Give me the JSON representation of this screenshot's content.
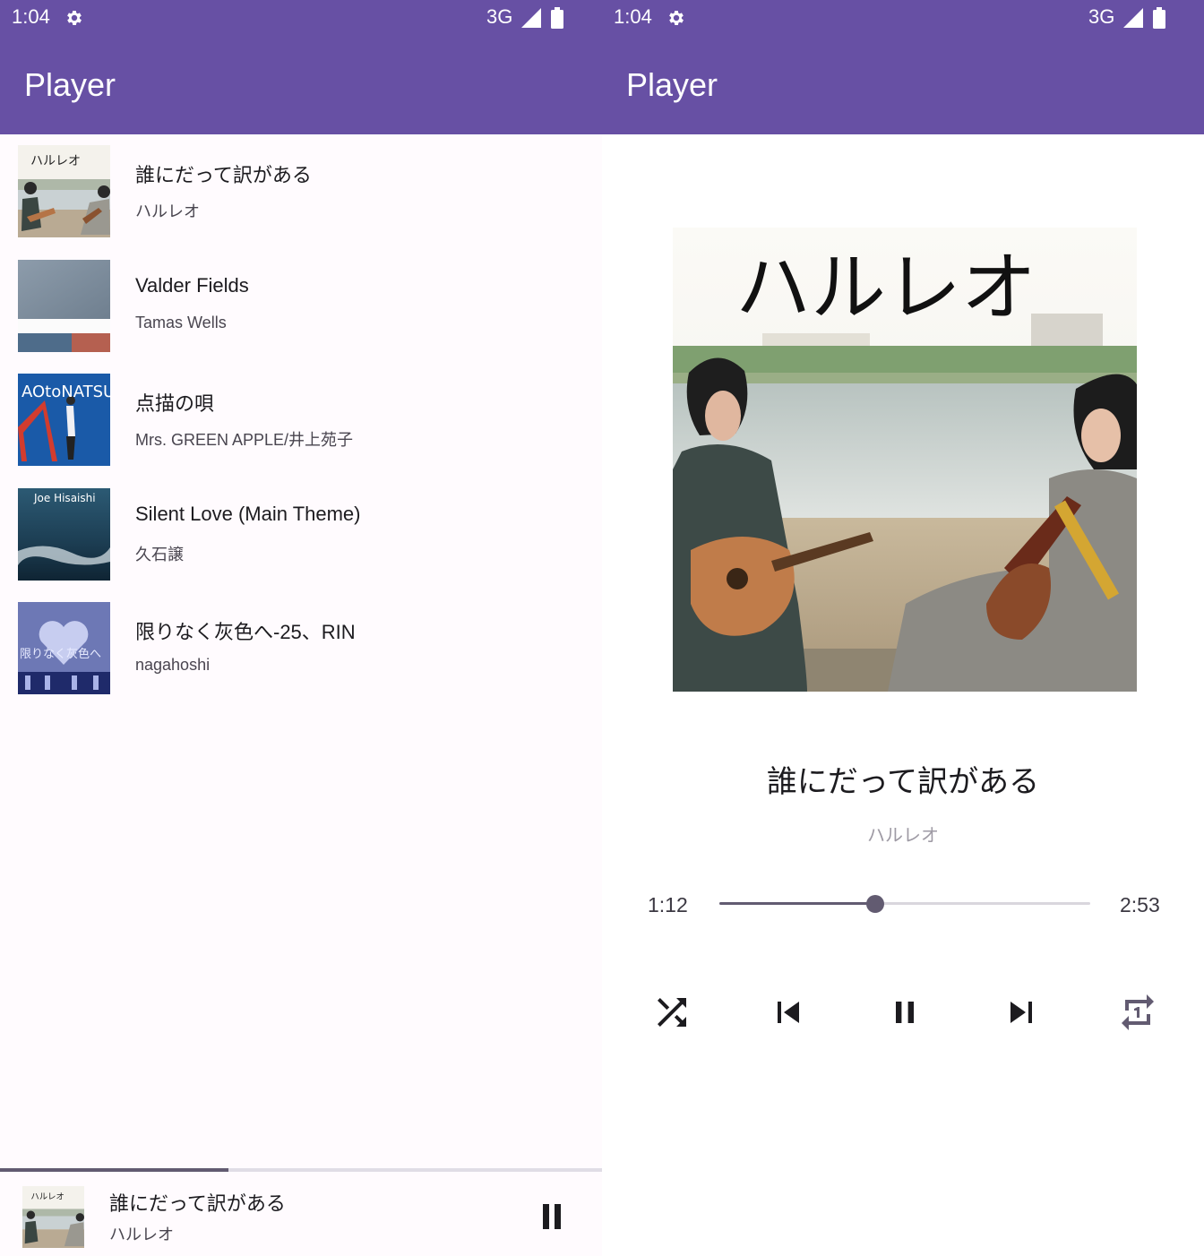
{
  "status_bar": {
    "time": "1:04",
    "network": "3G",
    "icons": [
      "gear-icon",
      "signal-icon",
      "battery-icon"
    ]
  },
  "app_bar": {
    "title": "Player"
  },
  "colors": {
    "primary": "#6750a4",
    "accent": "#625b71",
    "background": "#fffbfe"
  },
  "songs": [
    {
      "title": "誰にだって訳がある",
      "artist": "ハルレオ",
      "art_text": "ハルレオ"
    },
    {
      "title": "Valder Fields",
      "artist": "Tamas Wells",
      "art_text": ""
    },
    {
      "title": "点描の唄",
      "artist": "Mrs. GREEN APPLE/井上苑子",
      "art_text": "AOtoNATSU"
    },
    {
      "title": "Silent Love (Main Theme)",
      "artist": "久石譲",
      "art_text": "Joe Hisaishi"
    },
    {
      "title": "限りなく灰色へ-25、RIN",
      "artist": "nagahoshi",
      "art_text": "限りなく灰色へ"
    }
  ],
  "mini_player": {
    "title": "誰にだって訳がある",
    "artist": "ハルレオ",
    "progress": 0.38,
    "action_icon": "pause-icon"
  },
  "now_playing": {
    "art_text": "ハルレオ",
    "title": "誰にだって訳がある",
    "artist": "ハルレオ",
    "elapsed": "1:12",
    "total": "2:53",
    "progress": 0.42,
    "controls": [
      "shuffle-icon",
      "skip-previous-icon",
      "pause-icon",
      "skip-next-icon",
      "repeat-one-icon"
    ]
  }
}
